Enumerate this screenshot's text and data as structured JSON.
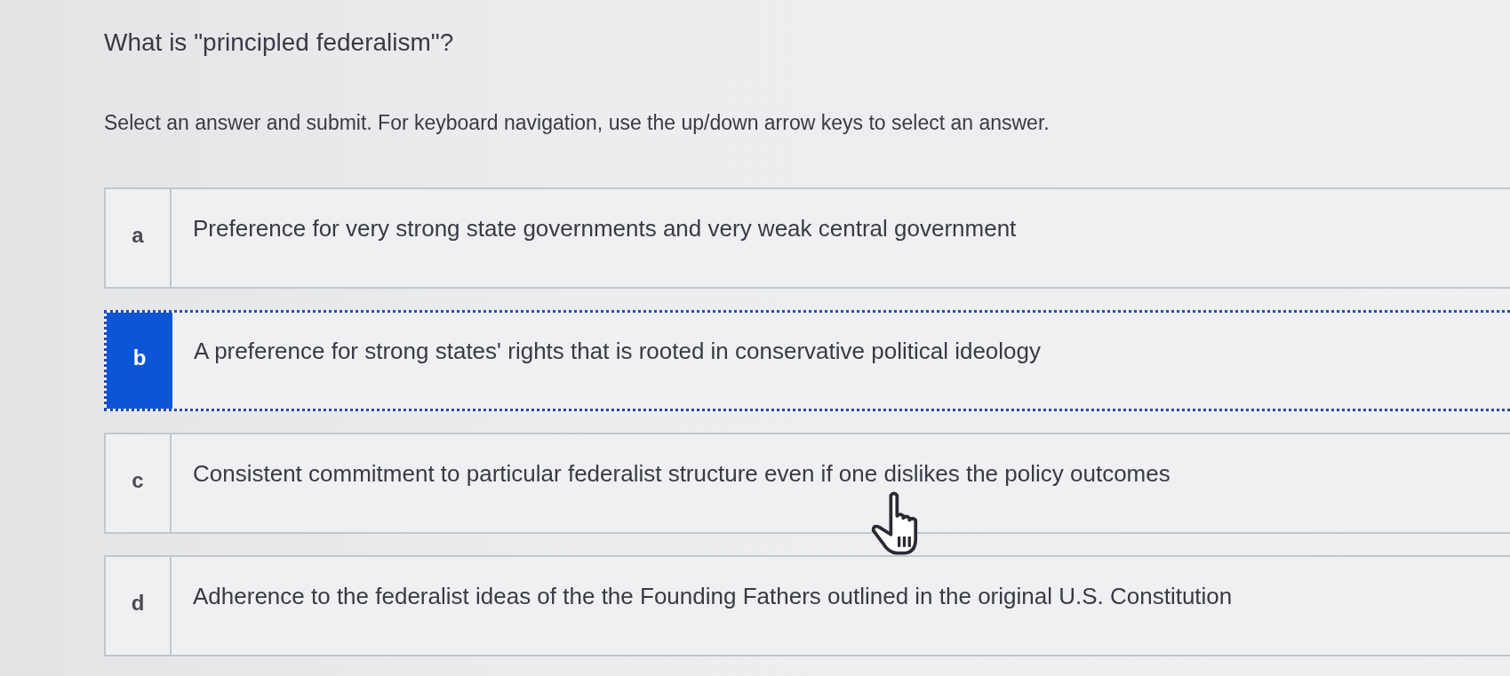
{
  "question": {
    "title": "What is \"principled federalism\"?",
    "instructions": "Select an answer and submit. For keyboard navigation, use the up/down arrow keys to select an answer."
  },
  "options": [
    {
      "letter": "a",
      "text": "Preference for very strong state governments and very weak central government",
      "selected": false
    },
    {
      "letter": "b",
      "text": "A preference for strong states' rights that is rooted in conservative political ideology",
      "selected": true
    },
    {
      "letter": "c",
      "text": "Consistent commitment to particular federalist structure even if one dislikes the policy outcomes",
      "selected": false
    },
    {
      "letter": "d",
      "text": "Adherence to the federalist ideas of the the Founding Fathers outlined in the original U.S. Constitution",
      "selected": false
    }
  ]
}
